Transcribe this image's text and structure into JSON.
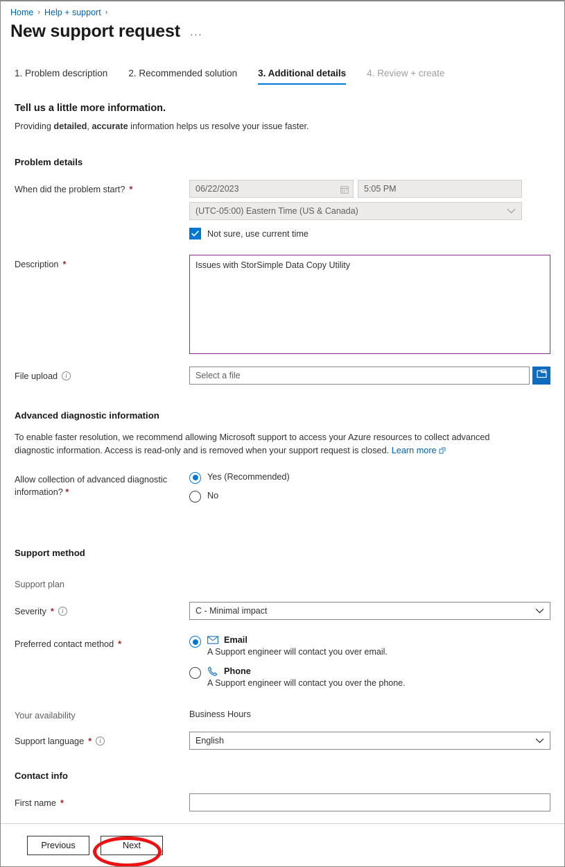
{
  "breadcrumb": {
    "items": [
      "Home",
      "Help + support"
    ],
    "separator": "›"
  },
  "header": {
    "title": "New support request",
    "more_menu": "···"
  },
  "tabs": [
    {
      "label": "1. Problem description",
      "state": "enabled"
    },
    {
      "label": "2. Recommended solution",
      "state": "enabled"
    },
    {
      "label": "3. Additional details",
      "state": "active"
    },
    {
      "label": "4. Review + create",
      "state": "disabled"
    }
  ],
  "lead": {
    "heading": "Tell us a little more information.",
    "sub_prefix": "Providing ",
    "sub_bold1": "detailed",
    "sub_mid": ", ",
    "sub_bold2": "accurate",
    "sub_suffix": " information helps us resolve your issue faster."
  },
  "problem_details": {
    "heading": "Problem details",
    "when_label": "When did the problem start?",
    "date_value": "06/22/2023",
    "time_value": "5:05 PM",
    "timezone_value": "(UTC-05:00) Eastern Time (US & Canada)",
    "not_sure_label": "Not sure, use current time",
    "not_sure_checked": "true",
    "description_label": "Description",
    "description_value": "Issues with StorSimple Data Copy Utility",
    "file_upload_label": "File upload",
    "file_placeholder": "Select a file"
  },
  "advanced": {
    "heading": "Advanced diagnostic information",
    "note_line": "To enable faster resolution, we recommend allowing Microsoft support to access your Azure resources to collect advanced diagnostic information. Access is read-only and is removed when your support request is closed. ",
    "learn_more": "Learn more",
    "allow_label_line1": "Allow collection of advanced diagnostic",
    "allow_label_line2": "information?",
    "options": [
      {
        "label": "Yes (Recommended)",
        "selected": "true"
      },
      {
        "label": "No",
        "selected": "false"
      }
    ]
  },
  "support_method": {
    "heading": "Support method",
    "support_plan_label": "Support plan",
    "support_plan_value": "",
    "severity_label": "Severity",
    "severity_value": "C - Minimal impact",
    "contact_method_label": "Preferred contact method",
    "contact_options": [
      {
        "label": "Email",
        "description": "A Support engineer will contact you over email.",
        "selected": "true",
        "icon": "envelope-icon"
      },
      {
        "label": "Phone",
        "description": "A Support engineer will contact you over the phone.",
        "selected": "false",
        "icon": "phone-icon"
      }
    ],
    "availability_label": "Your availability",
    "availability_value": "Business Hours",
    "language_label": "Support language",
    "language_value": "English"
  },
  "contact_info": {
    "heading": "Contact info",
    "first_name_label": "First name",
    "first_name_value": ""
  },
  "footer": {
    "previous_label": "Previous",
    "next_label": "Next"
  },
  "colors": {
    "accent_blue": "#0078d4",
    "link_blue": "#0063b1",
    "required_red": "#a4262c",
    "focus_purple": "#8b2a8b",
    "annotation_red": "#ee1111"
  }
}
